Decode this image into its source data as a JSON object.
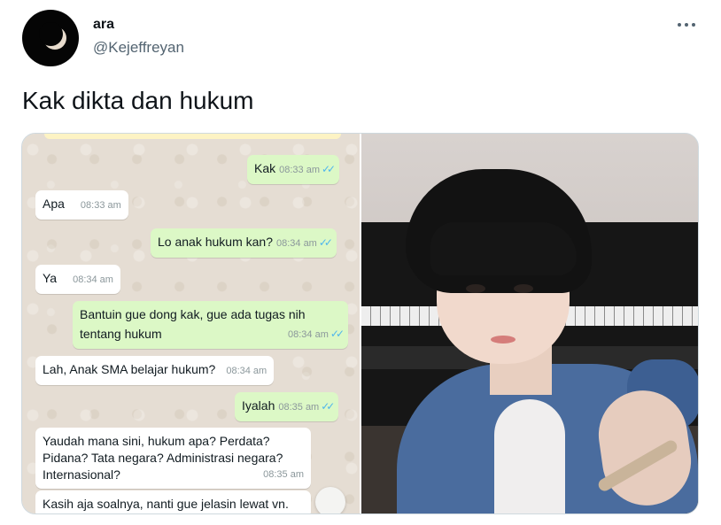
{
  "tweet": {
    "display_name": "ara",
    "handle": "@Kejeffreyan",
    "text": "Kak dikta dan hukum",
    "more_icon": "more-horizontal-icon",
    "avatar_icon": "crescent-moon-avatar"
  },
  "chat": {
    "messages": [
      {
        "side": "out",
        "text": "Kak",
        "time": "08:33 am",
        "ticks": "✓✓"
      },
      {
        "side": "in",
        "text": "Apa",
        "time": "08:33 am"
      },
      {
        "side": "out",
        "text": "Lo anak hukum kan?",
        "time": "08:34 am",
        "ticks": "✓✓"
      },
      {
        "side": "in",
        "text": "Ya",
        "time": "08:34 am"
      },
      {
        "side": "out",
        "line1": "Bantuin gue dong kak, gue ada tugas nih",
        "line2": "tentang hukum",
        "time": "08:34 am",
        "ticks": "✓✓"
      },
      {
        "side": "in",
        "text": "Lah, Anak SMA belajar hukum?",
        "time": "08:34 am"
      },
      {
        "side": "out",
        "text": "Iyalah",
        "time": "08:35 am",
        "ticks": "✓✓"
      },
      {
        "side": "in",
        "line1": "Yaudah mana sini, hukum apa? Perdata?",
        "line2": "Pidana? Tata negara? Administrasi negara?",
        "line3": "Internasional?",
        "time": "08:35 am"
      },
      {
        "side": "in",
        "text": "Kasih aja soalnya, nanti gue jelasin lewat vn."
      }
    ]
  },
  "colors": {
    "outgoing_bubble": "#dcf8c6",
    "incoming_bubble": "#ffffff",
    "chat_background": "#e5ddd3",
    "read_ticks": "#4fb6ec",
    "handle_gray": "#536471"
  }
}
